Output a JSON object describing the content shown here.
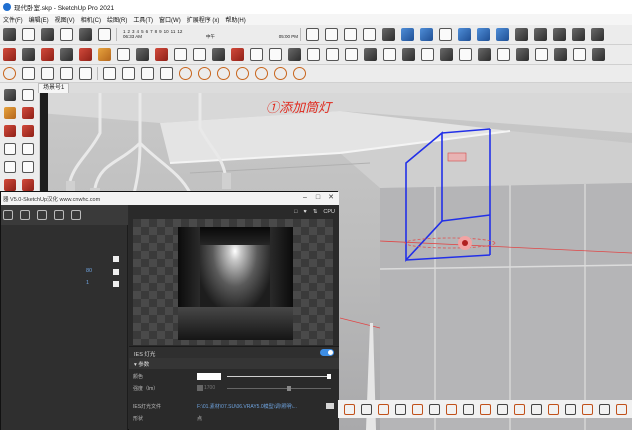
{
  "window": {
    "title": "现代卧室.skp - SketchUp Pro 2021"
  },
  "menu": {
    "items": [
      "文件(F)",
      "编辑(E)",
      "视图(V)",
      "相机(C)",
      "绘图(R)",
      "工具(T)",
      "窗口(W)",
      "扩展程序 (x)",
      "帮助(H)"
    ]
  },
  "toolbar": {
    "shadow_months": [
      "1",
      "2",
      "3",
      "4",
      "5",
      "6",
      "7",
      "8",
      "9",
      "10",
      "11",
      "12"
    ],
    "shadow_time_start": "06:33 AM",
    "shadow_time_mid": "中午",
    "shadow_time_end": "05:00 PM"
  },
  "scene": {
    "tab_label": "场景号1"
  },
  "viewport": {
    "annotation": "①添加筒灯",
    "annotation_color": "#e0281c"
  },
  "vray_panel": {
    "title": "器 V5.0-SketchUp汉化 www.cnwhc.com",
    "list_values": [
      "80",
      "1"
    ],
    "preview_toolbar": {
      "icons": [
        "square-icon",
        "cup-icon",
        "render-mode-icon",
        "cpu-icon"
      ],
      "cpu_label": "CPU"
    },
    "light_name": "IES 灯光",
    "section_label": "参数",
    "color_label": "颜色",
    "intensity_label": "强度（lm）",
    "intensity_value": "1700",
    "ies_file_label": "IES灯光文件",
    "ies_file_path": "F:\\01.素材\\07.SU\\06.VRAY5.0模型\\调\\照明\\...",
    "shape_label": "形状",
    "shape_value": "点",
    "toggle_on": true
  },
  "colors": {
    "accent_blue": "#3d8ee6",
    "panel_dark": "#2b2b2b",
    "link_blue": "#6fa4e0"
  }
}
